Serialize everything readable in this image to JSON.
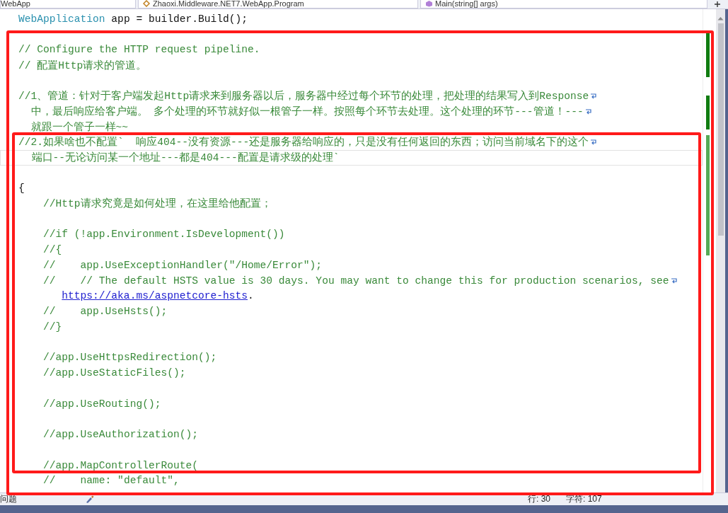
{
  "navigation_bar": {
    "project": "WebApp",
    "type": "Zhaoxi.Middleware.NET7.WebApp.Program",
    "member": "Main(string[] args)"
  },
  "code_lines": [
    {
      "kind": "code",
      "type_name": "WebApplication",
      "text": " app = builder.Build();"
    },
    {
      "kind": "blank"
    },
    {
      "kind": "comment",
      "text": "// Configure the HTTP request pipeline."
    },
    {
      "kind": "comment",
      "text": "// 配置Http请求的管道。"
    },
    {
      "kind": "blank"
    },
    {
      "kind": "comment",
      "text": "//1、管道：针对于客户端发起Http请求来到服务器以后，服务器中经过每个环节的处理，把处理的结果写入到Response",
      "wrap": true
    },
    {
      "kind": "continuation",
      "text": "中，最后响应给客户端。 多个处理的环节就好似一根管子一样。按照每个环节去处理。这个处理的环节---管道！---",
      "wrap": true
    },
    {
      "kind": "continuation",
      "text": "就跟一个管子一样~~"
    },
    {
      "kind": "comment",
      "text": "//2.如果啥也不配置`  响应404--没有资源---还是服务器给响应的，只是没有任何返回的东西；访问当前域名下的这个",
      "wrap": true
    },
    {
      "kind": "continuation",
      "text": "端口--无论访问某一个地址---都是404---配置是请求级的处理`",
      "current": true
    },
    {
      "kind": "blank"
    },
    {
      "kind": "plain",
      "text": "{"
    },
    {
      "kind": "comment",
      "text": "    //Http请求究竟是如何处理，在这里给他配置；"
    },
    {
      "kind": "blank"
    },
    {
      "kind": "comment",
      "text": "    //if (!app.Environment.IsDevelopment())"
    },
    {
      "kind": "comment",
      "text": "    //{"
    },
    {
      "kind": "comment",
      "text": "    //    app.UseExceptionHandler(\"/Home/Error\");"
    },
    {
      "kind": "comment",
      "text": "    //    // The default HSTS value is 30 days. You may want to change this for production scenarios, see",
      "wrap": true
    },
    {
      "kind": "link",
      "link": "https://aka.ms/aspnetcore-hsts",
      "text": "."
    },
    {
      "kind": "comment",
      "text": "    //    app.UseHsts();"
    },
    {
      "kind": "comment",
      "text": "    //}"
    },
    {
      "kind": "blank"
    },
    {
      "kind": "comment",
      "text": "    //app.UseHttpsRedirection();"
    },
    {
      "kind": "comment",
      "text": "    //app.UseStaticFiles();"
    },
    {
      "kind": "blank"
    },
    {
      "kind": "comment",
      "text": "    //app.UseRouting();"
    },
    {
      "kind": "blank"
    },
    {
      "kind": "comment",
      "text": "    //app.UseAuthorization();"
    },
    {
      "kind": "blank"
    },
    {
      "kind": "comment",
      "text": "    //app.MapControllerRoute("
    },
    {
      "kind": "comment",
      "text": "    //    name: \"default\","
    }
  ],
  "status_bar": {
    "issues": "问题",
    "line": "行: 30",
    "column": "字符: 107"
  }
}
